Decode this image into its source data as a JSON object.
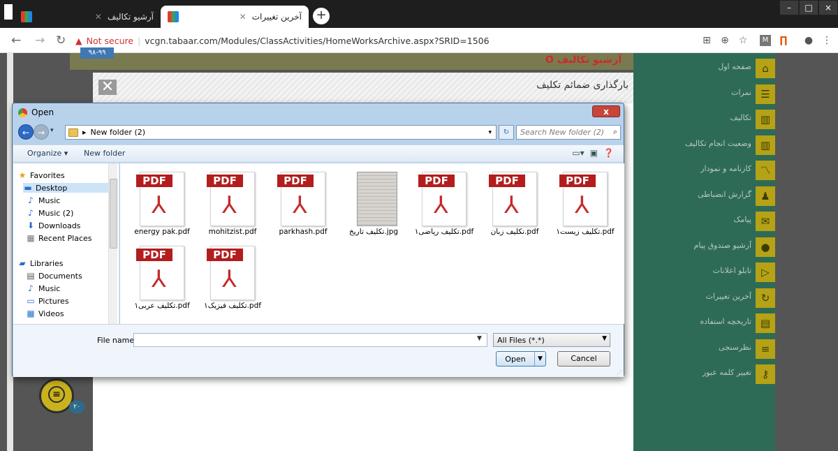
{
  "browser": {
    "tabs": [
      {
        "title": "آرشیو تکالیف",
        "active": true
      },
      {
        "title": "آخرین تغییرات",
        "active": false
      }
    ],
    "new_tab_symbol": "+",
    "url_warning": "Not secure",
    "url": "vcgn.tabaar.com/Modules/ClassActivities/HomeWorksArchive.aspx?SRID=1506",
    "window_buttons": [
      "–",
      "□",
      "×"
    ]
  },
  "page": {
    "year_badge": "۹۸-۹۹",
    "archive_title": "O آرشیو تکالیف",
    "modal_title": "بارگذاری ضمائم تکلیف",
    "modal_close": "✕",
    "chat_count": "۲۰",
    "sidebar": [
      {
        "label": "صفحه اول",
        "icon": "home-icon",
        "glyph": "⌂"
      },
      {
        "label": "نمرات",
        "icon": "list-icon",
        "glyph": "☰"
      },
      {
        "label": "تکالیف",
        "icon": "book-icon",
        "glyph": "▥"
      },
      {
        "label": "وضعیت انجام تکالیف",
        "icon": "book-icon",
        "glyph": "▥"
      },
      {
        "label": "کارنامه و نمودار",
        "icon": "chart-icon",
        "glyph": "〽"
      },
      {
        "label": "گزارش انضباطی",
        "icon": "users-icon",
        "glyph": "♟"
      },
      {
        "label": "پیامک",
        "icon": "mail-icon",
        "glyph": "✉"
      },
      {
        "label": "آرشیو صندوق پیام",
        "icon": "chat-icon",
        "glyph": "●"
      },
      {
        "label": "تابلو اعلانات",
        "icon": "announce-icon",
        "glyph": "▷"
      },
      {
        "label": "آخرین تغییرات",
        "icon": "refresh-icon",
        "glyph": "↻"
      },
      {
        "label": "تاریخچه استفاده",
        "icon": "archive-icon",
        "glyph": "▤"
      },
      {
        "label": "نظرسنجی",
        "icon": "poll-icon",
        "glyph": "≡"
      },
      {
        "label": "تغییر کلمه عبور",
        "icon": "key-icon",
        "glyph": "⚷"
      }
    ]
  },
  "dialog": {
    "title": "Open",
    "close": "x",
    "path": "New folder (2)",
    "search_placeholder": "Search New folder (2)",
    "organize": "Organize ▾",
    "new_folder": "New folder",
    "nav": {
      "favorites": "Favorites",
      "items": [
        "Desktop",
        "Music",
        "Music (2)",
        "Downloads",
        "Recent Places"
      ],
      "libraries": "Libraries",
      "library_items": [
        "Documents",
        "Music",
        "Pictures",
        "Videos"
      ]
    },
    "files": [
      {
        "name": "energy pak.pdf",
        "kind": "pdf"
      },
      {
        "name": "mohitzist.pdf",
        "kind": "pdf"
      },
      {
        "name": "parkhash.pdf",
        "kind": "pdf"
      },
      {
        "name": "تکلیف تاریخ.jpg",
        "kind": "jpg"
      },
      {
        "name": "تکلیف ریاضی۱.pdf",
        "kind": "pdf"
      },
      {
        "name": "تکلیف زبان.pdf",
        "kind": "pdf"
      },
      {
        "name": "تکلیف زیست۱.pdf",
        "kind": "pdf"
      },
      {
        "name": "تکلیف عربی۱.pdf",
        "kind": "pdf"
      },
      {
        "name": "تکلیف فیزیک۱.pdf",
        "kind": "pdf"
      }
    ],
    "pdf_label": "PDF",
    "file_name_label": "File name:",
    "file_name_value": "",
    "filter": "All Files (*.*)",
    "open": "Open",
    "cancel": "Cancel"
  }
}
